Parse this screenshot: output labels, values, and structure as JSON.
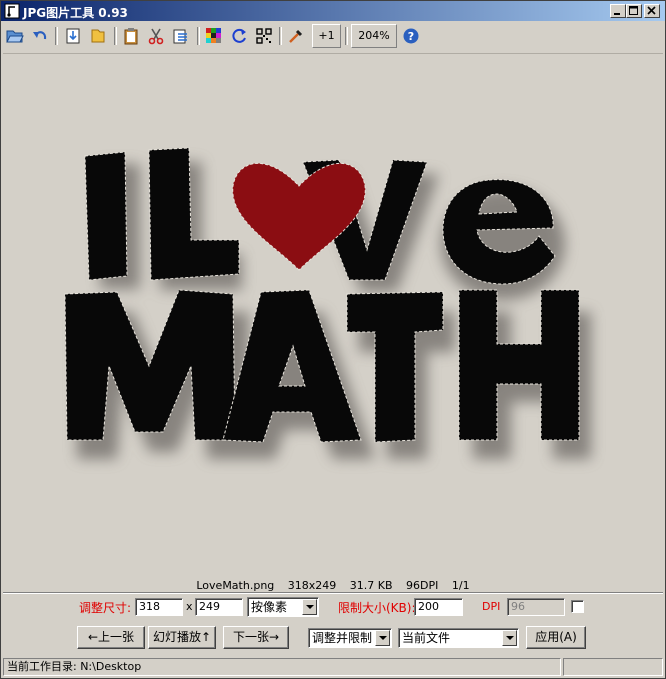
{
  "window": {
    "title": "JPG图片工具 0.93"
  },
  "toolbar": {
    "icons": [
      "open-folder-icon",
      "undo-icon",
      "save-icon",
      "folder-icon",
      "clipboard-icon",
      "scissors-icon",
      "paste-icon",
      "color-grid-icon",
      "rotate-icon",
      "qr-icon",
      "eyedropper-icon"
    ],
    "plus_one": "+1",
    "zoom": "204%"
  },
  "image": {
    "line1": "I L",
    "line1b": "ve",
    "line2": "MATH",
    "heart_color": "#8b0d12"
  },
  "fileinfo": {
    "filename": "LoveMath.png",
    "dimensions": "318x249",
    "filesize": "31.7 KB",
    "dpi": "96DPI",
    "page": "1/1"
  },
  "resize": {
    "label": "调整尺寸:",
    "width": "318",
    "x": "x",
    "height": "249",
    "unit": "按像素",
    "limit_label": "限制大小(KB):",
    "limit_value": "200",
    "dpi_label": "DPI",
    "dpi_value": "96"
  },
  "actions": {
    "prev": "←上一张",
    "slideshow": "幻灯播放↑",
    "next": "下一张→",
    "mode": "调整并限制",
    "target": "当前文件",
    "apply": "应用(A)"
  },
  "status": {
    "workdir": "当前工作目录: N:\\Desktop"
  }
}
